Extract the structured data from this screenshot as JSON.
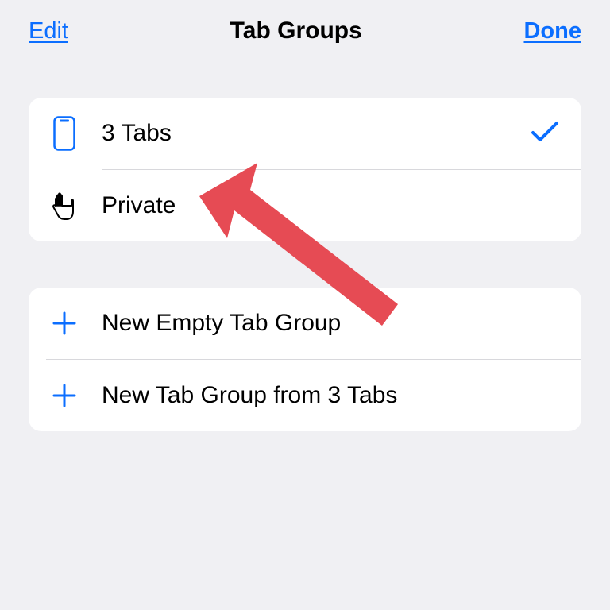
{
  "header": {
    "edit_label": "Edit",
    "title": "Tab Groups",
    "done_label": "Done"
  },
  "groups": [
    {
      "label": "3 Tabs",
      "selected": true
    },
    {
      "label": "Private",
      "selected": false
    }
  ],
  "actions": [
    {
      "label": "New Empty Tab Group"
    },
    {
      "label": "New Tab Group from 3 Tabs"
    }
  ]
}
